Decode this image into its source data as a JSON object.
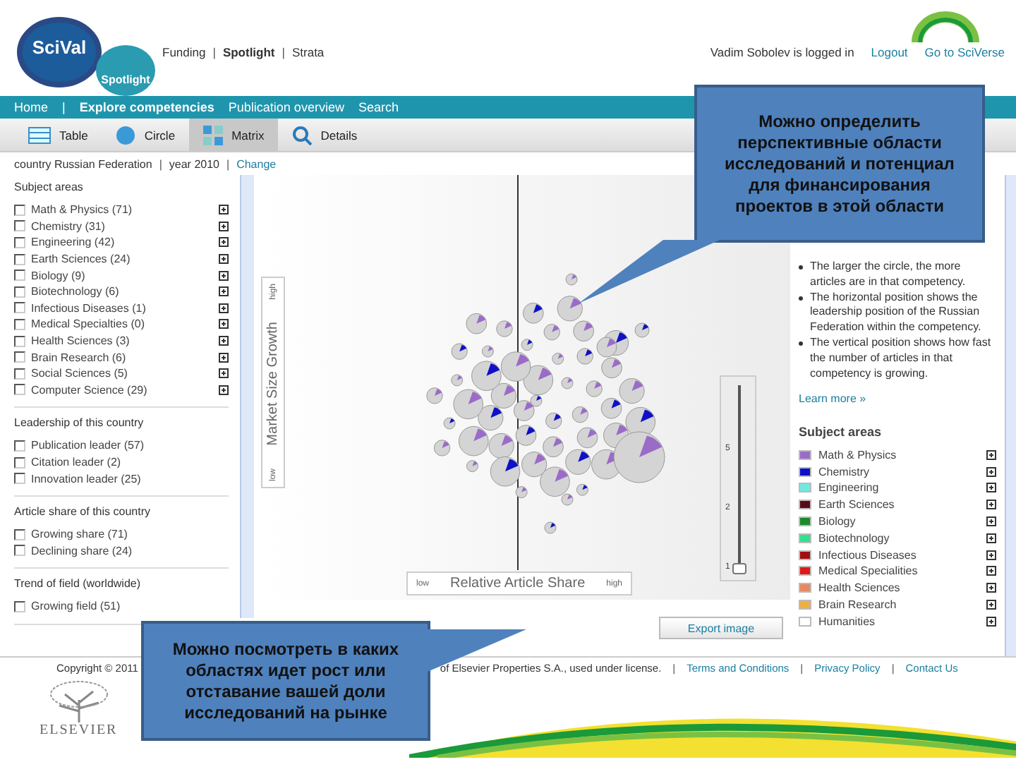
{
  "header": {
    "logo": {
      "title": "SciVal",
      "subtitle": "Spotlight"
    },
    "product_separators": [
      "|",
      "|"
    ],
    "product_links": [
      {
        "label": "Funding",
        "selected": false
      },
      {
        "label": "Spotlight",
        "selected": true
      },
      {
        "label": "Strata",
        "selected": false
      }
    ],
    "user": "Vadim Sobolev is logged in",
    "logout": "Logout",
    "sciverse": "Go to SciVerse"
  },
  "nav_separators": [
    "|"
  ],
  "nav": [
    {
      "label": "Home",
      "selected": false
    },
    {
      "label": "Explore competencies",
      "selected": true
    },
    {
      "label": "Publication overview",
      "selected": false
    },
    {
      "label": "Search",
      "selected": false
    }
  ],
  "view_tabs": [
    {
      "label": "Table",
      "kind": "table",
      "selected": false
    },
    {
      "label": "Circle",
      "kind": "circle",
      "selected": false
    },
    {
      "label": "Matrix",
      "kind": "matrix",
      "selected": true
    },
    {
      "label": "Details",
      "kind": "details",
      "selected": false
    }
  ],
  "context": {
    "separators": [
      "|",
      "|"
    ],
    "country": "country Russian Federation",
    "year": "year 2010",
    "change": "Change"
  },
  "filters": [
    {
      "title": "Subject areas",
      "items": [
        {
          "label": "Math & Physics (71)",
          "checked": false,
          "expandable": true
        },
        {
          "label": "Chemistry (31)",
          "checked": false,
          "expandable": true
        },
        {
          "label": "Engineering (42)",
          "checked": false,
          "expandable": true
        },
        {
          "label": "Earth Sciences (24)",
          "checked": false,
          "expandable": true
        },
        {
          "label": "Biology (9)",
          "checked": false,
          "expandable": true
        },
        {
          "label": "Biotechnology (6)",
          "checked": false,
          "expandable": true
        },
        {
          "label": "Infectious Diseases (1)",
          "checked": false,
          "expandable": true
        },
        {
          "label": "Medical Specialties (0)",
          "checked": false,
          "expandable": true
        },
        {
          "label": "Health Sciences (3)",
          "checked": false,
          "expandable": true
        },
        {
          "label": "Brain Research (6)",
          "checked": false,
          "expandable": true
        },
        {
          "label": "Social Sciences (5)",
          "checked": false,
          "expandable": true
        },
        {
          "label": "Computer Science (29)",
          "checked": false,
          "expandable": true
        }
      ]
    },
    {
      "title": "Leadership of this country",
      "items": [
        {
          "label": "Publication leader (57)",
          "checked": false,
          "expandable": false
        },
        {
          "label": "Citation leader (2)",
          "checked": false,
          "expandable": false
        },
        {
          "label": "Innovation leader (25)",
          "checked": false,
          "expandable": false
        }
      ]
    },
    {
      "title": "Article share of this country",
      "items": [
        {
          "label": "Growing share (71)",
          "checked": false,
          "expandable": false
        },
        {
          "label": "Declining share (24)",
          "checked": false,
          "expandable": false
        }
      ]
    },
    {
      "title": "Trend of field (worldwide)",
      "items": [
        {
          "label": "Growing field (51)",
          "checked": false,
          "expandable": false
        }
      ]
    }
  ],
  "matrix": {
    "y_axis": {
      "label": "Market Size Growth",
      "low": "low",
      "high": "high"
    },
    "x_axis": {
      "label": "Relative Article Share",
      "low": "low",
      "high": "high"
    },
    "zoom_slider": {
      "ticks": [
        "5",
        "2",
        "1"
      ],
      "level": 0
    },
    "export": "Export image"
  },
  "info": {
    "bullets": [
      "The larger the circle, the more articles are in that competency.",
      "The horizontal position shows the leadership position of the Russian Federation within the competency.",
      "The vertical position shows how fast the number of articles in that competency is growing."
    ],
    "learn_more": "Learn more »"
  },
  "legend": {
    "title": "Subject areas",
    "items": [
      {
        "label": "Math & Physics",
        "color": "#9b6bc8"
      },
      {
        "label": "Chemistry",
        "color": "#1010c8"
      },
      {
        "label": "Engineering",
        "color": "#70e8e0"
      },
      {
        "label": "Earth Sciences",
        "color": "#5a0a14"
      },
      {
        "label": "Biology",
        "color": "#1a8a2a"
      },
      {
        "label": "Biotechnology",
        "color": "#30e090"
      },
      {
        "label": "Infectious Diseases",
        "color": "#a01010"
      },
      {
        "label": "Medical Specialities",
        "color": "#e01818"
      },
      {
        "label": "Health Sciences",
        "color": "#e88860"
      },
      {
        "label": "Brain Research",
        "color": "#f0b040"
      },
      {
        "label": "Humanities",
        "color": "#ffffff"
      }
    ]
  },
  "footer": {
    "copyright": "Copyright © 2011",
    "license": "of Elsevier Properties S.A., used under license.",
    "separators": [
      "|",
      "|",
      "|"
    ],
    "links": [
      "Terms and Conditions",
      "Privacy Policy",
      "Contact Us"
    ],
    "publisher": "ELSEVIER"
  },
  "callouts": [
    {
      "text": "Можно определить перспективные области исследований и потенциал для финансирования проектов в этой области"
    },
    {
      "text": "Можно посмотреть в каких областях идет рост или отставание вашей доли исследований на рынке"
    }
  ]
}
